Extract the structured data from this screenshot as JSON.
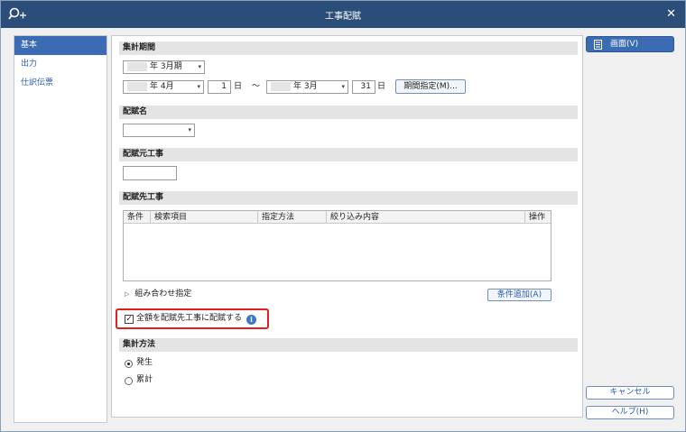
{
  "window": {
    "title": "工事配賦"
  },
  "sidebar": {
    "items": [
      {
        "label": "基本",
        "active": true
      },
      {
        "label": "出力",
        "active": false
      },
      {
        "label": "仕訳伝票",
        "active": false
      }
    ]
  },
  "period": {
    "section": "集計期間",
    "fiscal_year_select": "年  3月期",
    "from_month": "年  4月",
    "from_day": "1",
    "from_day_unit": "日",
    "range_sep": "～",
    "to_month": "年  3月",
    "to_day": "31",
    "to_day_unit": "日",
    "period_button": "期間指定(M)..."
  },
  "allocation_name": {
    "section": "配賦名",
    "value": ""
  },
  "source": {
    "section": "配賦元工事",
    "value": ""
  },
  "destination": {
    "section": "配賦先工事",
    "columns": [
      "条件",
      "検索項目",
      "指定方法",
      "絞り込み内容",
      "操作"
    ],
    "rows": [],
    "combination_label": "組み合わせ指定",
    "add_condition_button": "条件追加(A)",
    "all_amount_label": "全額を配賦先工事に配賦する",
    "all_amount_checked": true
  },
  "method": {
    "section": "集計方法",
    "options": [
      {
        "label": "発生",
        "selected": true
      },
      {
        "label": "累計",
        "selected": false
      }
    ]
  },
  "actions": {
    "display_button": "画面(V)",
    "cancel_button": "キャンセル",
    "help_button": "ヘルプ(H)"
  },
  "colors": {
    "titlebar": "#2b4d7a",
    "accent": "#3a6bb3",
    "highlight": "#e01f1f"
  }
}
